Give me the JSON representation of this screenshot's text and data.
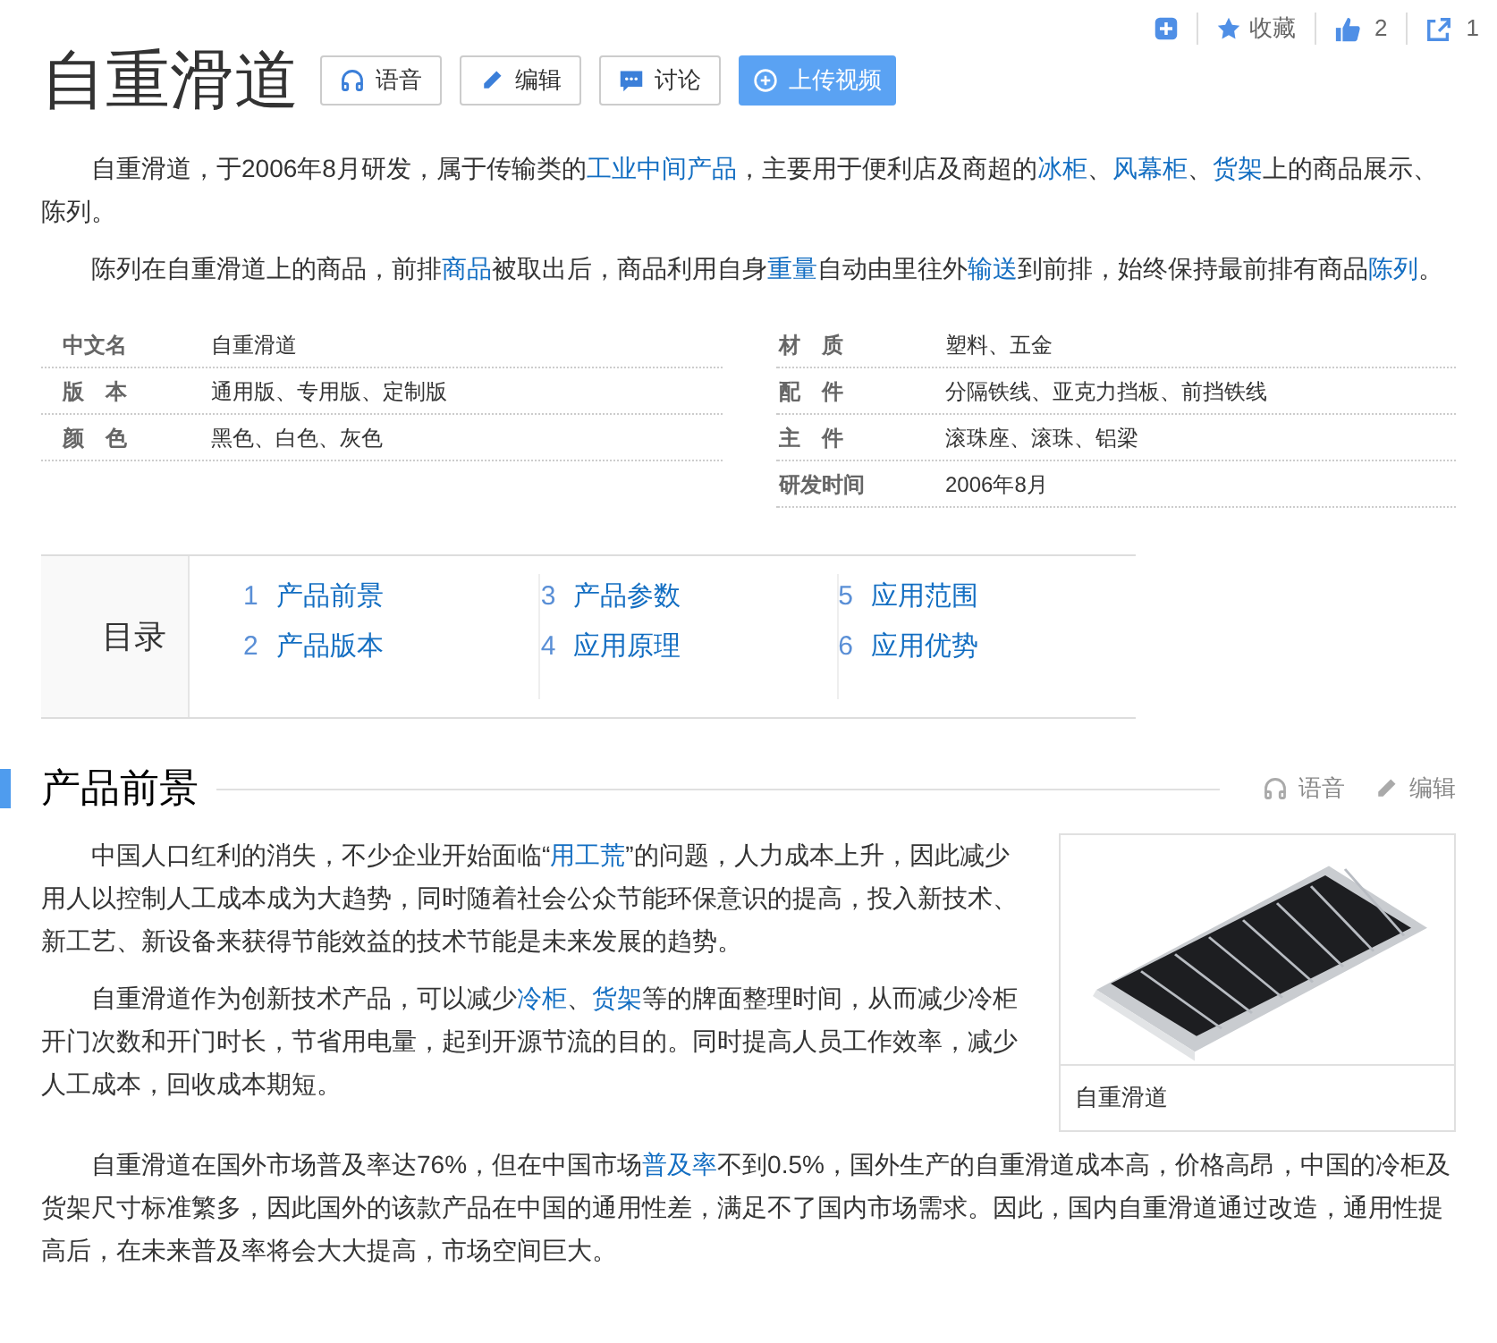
{
  "top_bar": {
    "collect": "收藏",
    "likes": "2",
    "shares": "1"
  },
  "title": "自重滑道",
  "title_buttons": [
    {
      "kind": "audio",
      "label": "语音"
    },
    {
      "kind": "edit",
      "label": "编辑"
    },
    {
      "kind": "discuss",
      "label": "讨论"
    },
    {
      "kind": "upload",
      "label": "上传视频"
    }
  ],
  "intro": [
    [
      {
        "kind": "text",
        "text": "自重滑道，于2006年8月研发，属于传输类的"
      },
      {
        "kind": "link",
        "text": "工业中间产品"
      },
      {
        "kind": "text",
        "text": "，主要用于便利店及商超的"
      },
      {
        "kind": "link",
        "text": "冰柜"
      },
      {
        "kind": "text",
        "text": "、"
      },
      {
        "kind": "link",
        "text": "风幕柜"
      },
      {
        "kind": "text",
        "text": "、"
      },
      {
        "kind": "link",
        "text": "货架"
      },
      {
        "kind": "text",
        "text": "上的商品展示、陈列。"
      }
    ],
    [
      {
        "kind": "text",
        "text": "陈列在自重滑道上的商品，前排"
      },
      {
        "kind": "link",
        "text": "商品"
      },
      {
        "kind": "text",
        "text": "被取出后，商品利用自身"
      },
      {
        "kind": "link",
        "text": "重量"
      },
      {
        "kind": "text",
        "text": "自动由里往外"
      },
      {
        "kind": "link",
        "text": "输送"
      },
      {
        "kind": "text",
        "text": "到前排，始终保持最前排有商品"
      },
      {
        "kind": "link",
        "text": "陈列"
      },
      {
        "kind": "text",
        "text": "。"
      }
    ]
  ],
  "basic_info": [
    {
      "name": "中文名",
      "value": "自重滑道",
      "name_2": "材　质",
      "value_2": "塑料、五金"
    },
    {
      "name": "版　本",
      "value": "通用版、专用版、定制版",
      "name_2": "配　件",
      "value_2": "分隔铁线、亚克力挡板、前挡铁线"
    },
    {
      "name": "颜　色",
      "value": "黑色、白色、灰色",
      "name_2": "主　件",
      "value_2": "滚珠座、滚珠、铝梁"
    },
    {
      "name_2": "研发时间",
      "value_2": "2006年8月"
    }
  ],
  "toc": {
    "title": "目录",
    "items": [
      {
        "number": "1",
        "label": "产品前景"
      },
      {
        "number": "2",
        "label": "产品版本"
      },
      {
        "number": "3",
        "label": "产品参数"
      },
      {
        "number": "4",
        "label": "应用原理"
      },
      {
        "number": "5",
        "label": "应用范围"
      },
      {
        "number": "6",
        "label": "应用优势"
      }
    ]
  },
  "section": {
    "title": "产品前景",
    "actions": [
      {
        "kind": "audio",
        "label": "语音"
      },
      {
        "kind": "edit",
        "label": "编辑"
      }
    ],
    "image": {
      "kind": "picture",
      "caption": "自重滑道"
    },
    "paragraphs": [
      [
        {
          "kind": "text",
          "text": "中国人口红利的消失，不少企业开始面临“"
        },
        {
          "kind": "link",
          "text": "用工荒"
        },
        {
          "kind": "text",
          "text": "”的问题，人力成本上升，因此减少用人以控制人工成本成为大趋势，同时随着社会公众节能环保意识的提高，投入新技术、新工艺、新设备来获得节能效益的技术节能是未来发展的趋势。"
        }
      ],
      [
        {
          "kind": "text",
          "text": "自重滑道作为创新技术产品，可以减少"
        },
        {
          "kind": "link",
          "text": "冷柜"
        },
        {
          "kind": "text",
          "text": "、"
        },
        {
          "kind": "link",
          "text": "货架"
        },
        {
          "kind": "text",
          "text": "等的牌面整理时间，从而减少冷柜开门次数和开门时长，节省用电量，起到开源节流的目的。同时提高人员工作效率，减少人工成本，回收成本期短。"
        }
      ],
      [
        {
          "kind": "text",
          "text": "自重滑道在国外市场普及率达76%，但在中国市场"
        },
        {
          "kind": "link",
          "text": "普及率"
        },
        {
          "kind": "text",
          "text": "不到0.5%，国外生产的自重滑道成本高，价格高昂，中国的冷柜及货架尺寸标准繁多，因此国外的该款产品在中国的通用性差，满足不了国内市场需求。因此，国内自重滑道通过改造，通用性提高后，在未来普及率将会大大提高，市场空间巨大。"
        }
      ]
    ]
  }
}
